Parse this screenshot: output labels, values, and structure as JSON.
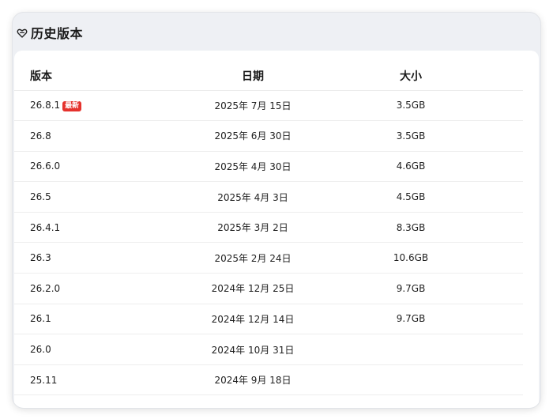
{
  "header": {
    "title": "历史版本",
    "icon": "heart-shield-icon"
  },
  "table": {
    "columns": [
      "版本",
      "日期",
      "大小"
    ],
    "rows": [
      {
        "version": "26.8.1",
        "badge": "最新",
        "date": "2025年 7月 15日",
        "size": "3.5GB"
      },
      {
        "version": "26.8",
        "date": "2025年 6月 30日",
        "size": "3.5GB"
      },
      {
        "version": "26.6.0",
        "date": "2025年 4月 30日",
        "size": "4.6GB"
      },
      {
        "version": "26.5",
        "date": "2025年 4月 3日",
        "size": "4.5GB"
      },
      {
        "version": "26.4.1",
        "date": "2025年 3月 2日",
        "size": "8.3GB"
      },
      {
        "version": "26.3",
        "date": "2025年 2月 24日",
        "size": "10.6GB"
      },
      {
        "version": "26.2.0",
        "date": "2024年 12月 25日",
        "size": "9.7GB"
      },
      {
        "version": "26.1",
        "date": "2024年 12月 14日",
        "size": "9.7GB"
      },
      {
        "version": "26.0",
        "date": "2024年 10月 31日",
        "size": ""
      },
      {
        "version": "25.11",
        "date": "2024年 9月 18日",
        "size": ""
      }
    ]
  },
  "colors": {
    "badge": "#e5322d",
    "header_bg": "#eef0f4"
  }
}
